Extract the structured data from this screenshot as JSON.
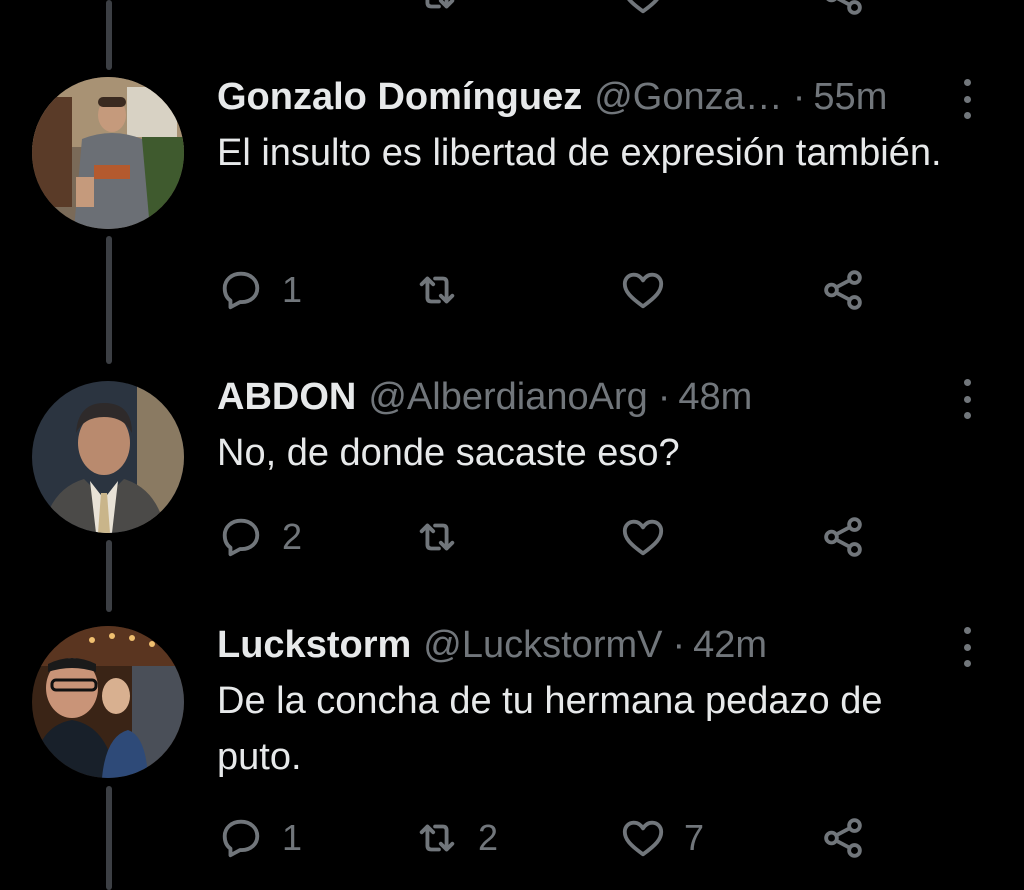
{
  "tweets": [
    {
      "name": "Gonzalo Domínguez",
      "handle": "@Gonza…",
      "separator": "·",
      "time": "55m",
      "text": "El insulto es libertad de expresión también.",
      "replies": "1",
      "retweets": "",
      "likes": ""
    },
    {
      "name": "ABDON",
      "handle": "@AlberdianoArg",
      "separator": "·",
      "time": "48m",
      "text": "No, de donde sacaste eso?",
      "replies": "2",
      "retweets": "",
      "likes": ""
    },
    {
      "name": "Luckstorm",
      "handle": "@LuckstormV",
      "separator": "·",
      "time": "42m",
      "text": "De la concha de tu hermana pedazo de puto.",
      "replies": "1",
      "retweets": "2",
      "likes": "7"
    }
  ],
  "icons": {
    "reply": "reply-icon",
    "retweet": "retweet-icon",
    "like": "heart-icon",
    "share": "share-icon",
    "more": "more-vertical-icon"
  },
  "colors": {
    "background": "#000000",
    "primary_text": "#e7e9ea",
    "secondary_text": "#71767b",
    "thread_line": "#3c3f44"
  }
}
